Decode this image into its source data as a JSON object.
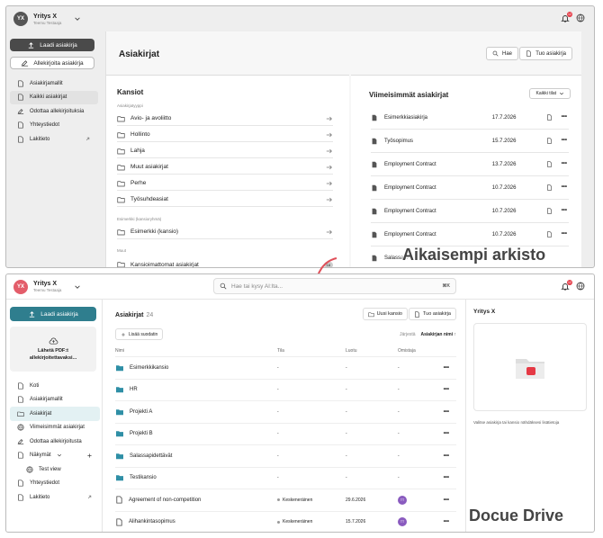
{
  "colors": {
    "old_primary": "#4a4a4a",
    "new_primary": "#2f7e8e",
    "badge": "#e53945",
    "avatar_new": "#e35d6a",
    "avatar_old": "#555555",
    "arrow": "#e0505a"
  },
  "company": {
    "name": "Yritys X",
    "subtitle": "Teemu Testaaja",
    "initials": "YX"
  },
  "notification_count": "12",
  "old": {
    "watermark": "Aikaisempi arkisto",
    "load_button": "Laadi asiakirja",
    "sign_button": "Allekirjoita asiakirja",
    "nav": [
      {
        "label": "Asiakirjamallit",
        "icon": "document-icon"
      },
      {
        "label": "Kaikki asiakirjat",
        "icon": "documents-icon"
      },
      {
        "label": "Odottaa allekirjoituksia",
        "icon": "signature-icon"
      },
      {
        "label": "Yhteystiedot",
        "icon": "book-icon"
      },
      {
        "label": "Lakitieto",
        "icon": "scale-icon"
      }
    ],
    "page_title": "Asiakirjat",
    "search_button": "Hae",
    "import_button": "Tuo asiakirja",
    "folders_title": "Kansiot",
    "section_type": "Asiakirjatyyppi",
    "folders": [
      "Avio- ja avoliitto",
      "Hollinto",
      "Lahja",
      "Muut asiakirjat",
      "Perhe",
      "Työsuhdeasiat"
    ],
    "section_example": "Esimerkki (kansioryhmä)",
    "example_folder": "Esimerkki (kansio)",
    "section_other": "Muut",
    "unfiled_folder": "Kansioimattomat asiakirjat",
    "unfiled_count": "18",
    "recent_title": "Viimeisimmät asiakirjat",
    "status_filter": "Kaikki tilat",
    "recent": [
      {
        "name": "Esimerkkiasiakirja",
        "date": "17.7.2026"
      },
      {
        "name": "Työsopimus",
        "date": "15.7.2026"
      },
      {
        "name": "Employment Contract",
        "date": "13.7.2026"
      },
      {
        "name": "Employment Contract",
        "date": "10.7.2026"
      },
      {
        "name": "Employment Contract",
        "date": "10.7.2026"
      },
      {
        "name": "Employment Contract",
        "date": "10.7.2026"
      },
      {
        "name": "Salassa...",
        "date": ""
      }
    ]
  },
  "new": {
    "watermark": "Docue Drive",
    "search_placeholder": "Hae tai kysy AI:lta...",
    "search_shortcut": "⌘K",
    "load_button": "Laadi asiakirja",
    "drop_line1": "Lähetä PDF:t",
    "drop_line2": "allekirjoitettavaksi...",
    "nav": [
      {
        "label": "Koti",
        "icon": "home-icon"
      },
      {
        "label": "Asiakirjamallit",
        "icon": "document-icon"
      },
      {
        "label": "Asiakirjat",
        "icon": "folder-icon"
      },
      {
        "label": "Viimeisimmät asiakirjat",
        "icon": "clock-icon"
      },
      {
        "label": "Odottaa allekirjoitusta",
        "icon": "signature-icon"
      },
      {
        "label": "Näkymät",
        "icon": "grid-icon"
      },
      {
        "label": "Test view",
        "icon": "view-icon"
      },
      {
        "label": "Yhteystiedot",
        "icon": "book-icon"
      },
      {
        "label": "Lakitieto",
        "icon": "scale-icon"
      }
    ],
    "header": "Asiakirjat",
    "count": "24",
    "new_folder": "Uusi kansio",
    "import_button": "Tuo asiakirja",
    "add_filter": "Lisää suodatin",
    "sort_label": "Järjestä",
    "sort_value": "Asiakirjan nimi ↑",
    "columns": [
      "Nimi",
      "Tila",
      "Luotu",
      "Omistaja"
    ],
    "rows": [
      {
        "name": "Esimerkkikansio",
        "type": "folder",
        "status": "-",
        "created": "-",
        "owner": "-"
      },
      {
        "name": "HR",
        "type": "folder",
        "status": "-",
        "created": "-",
        "owner": "-"
      },
      {
        "name": "Projekti A",
        "type": "folder",
        "status": "-",
        "created": "-",
        "owner": "-"
      },
      {
        "name": "Projekti B",
        "type": "folder",
        "status": "-",
        "created": "-",
        "owner": "-"
      },
      {
        "name": "Salassapidettävät",
        "type": "folder",
        "status": "-",
        "created": "-",
        "owner": "-"
      },
      {
        "name": "Testikansio",
        "type": "folder",
        "status": "-",
        "created": "-",
        "owner": "-"
      },
      {
        "name": "Agreement of non-competition",
        "type": "doc",
        "status": "Keskeneräinen",
        "created": "29.6.2026",
        "owner": "TT"
      },
      {
        "name": "Alihankintasopimus",
        "type": "doc",
        "status": "Keskeneräinen",
        "created": "15.7.2026",
        "owner": "TT"
      }
    ],
    "right_title": "Yritys X",
    "right_hint": "Valitse asiakirja tai kansio nähdäksesi lisätietoja"
  }
}
